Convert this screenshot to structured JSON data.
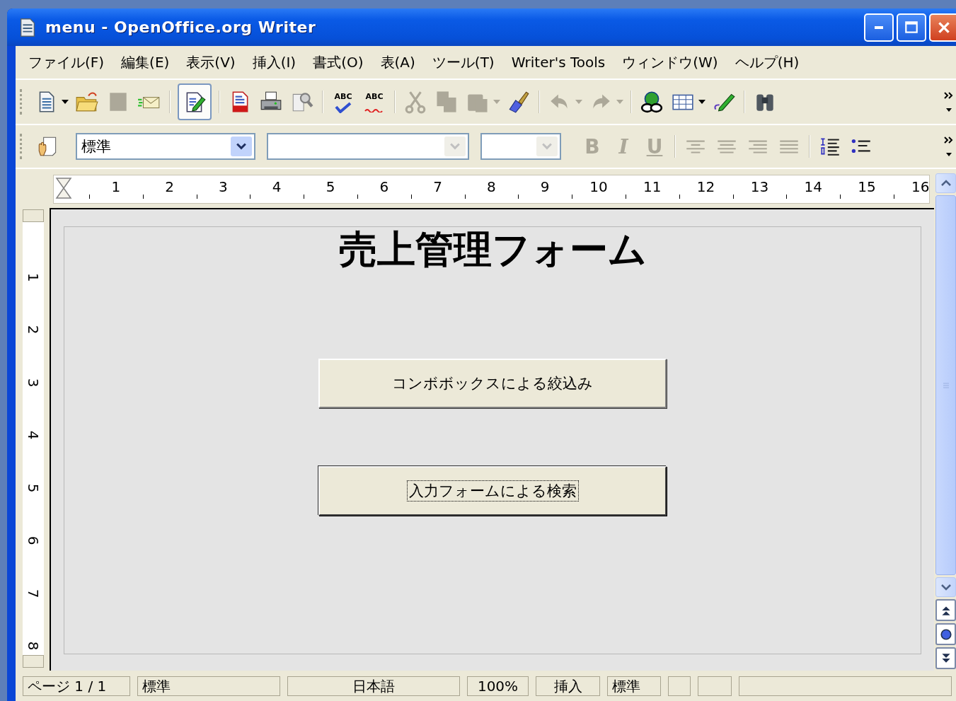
{
  "window": {
    "title": "menu - OpenOffice.org Writer"
  },
  "menu": [
    "ファイル(F)",
    "編集(E)",
    "表示(V)",
    "挿入(I)",
    "書式(O)",
    "表(A)",
    "ツール(T)",
    "Writer's Tools",
    "ウィンドウ(W)",
    "ヘルプ(H)"
  ],
  "toolbar": {
    "items": [
      {
        "kind": "new",
        "disabled": false,
        "on": false
      },
      {
        "kind": "dropdown",
        "disabled": false
      },
      {
        "kind": "open",
        "disabled": false,
        "on": false
      },
      {
        "kind": "save",
        "disabled": true,
        "on": false
      },
      {
        "kind": "email",
        "disabled": false,
        "on": false
      },
      {
        "kind": "separator"
      },
      {
        "kind": "edit",
        "disabled": false,
        "on": true
      },
      {
        "kind": "separator"
      },
      {
        "kind": "pdf",
        "disabled": false,
        "on": false
      },
      {
        "kind": "print",
        "disabled": false,
        "on": false
      },
      {
        "kind": "preview",
        "disabled": false,
        "on": false
      },
      {
        "kind": "separator"
      },
      {
        "kind": "spellcheck",
        "label": "ABC",
        "disabled": false,
        "on": false
      },
      {
        "kind": "autospell",
        "label": "ABC",
        "disabled": false,
        "on": false
      },
      {
        "kind": "separator"
      },
      {
        "kind": "cut",
        "disabled": true,
        "on": false
      },
      {
        "kind": "copy",
        "disabled": true,
        "on": false
      },
      {
        "kind": "paste",
        "disabled": true,
        "on": false
      },
      {
        "kind": "dropdown",
        "disabled": true
      },
      {
        "kind": "brush",
        "disabled": false,
        "on": false
      },
      {
        "kind": "separator"
      },
      {
        "kind": "undo",
        "disabled": true,
        "on": false
      },
      {
        "kind": "dropdown",
        "disabled": true
      },
      {
        "kind": "redo",
        "disabled": true,
        "on": false
      },
      {
        "kind": "dropdown",
        "disabled": true
      },
      {
        "kind": "separator"
      },
      {
        "kind": "globe",
        "disabled": false,
        "on": false
      },
      {
        "kind": "table",
        "disabled": false,
        "on": false
      },
      {
        "kind": "dropdown",
        "disabled": false
      },
      {
        "kind": "draw",
        "disabled": false,
        "on": false
      },
      {
        "kind": "separator"
      },
      {
        "kind": "find",
        "disabled": false,
        "on": false
      }
    ]
  },
  "format_bar": {
    "style_box": {
      "value": "標準",
      "disabled": false
    },
    "font_box": {
      "disabled": true
    },
    "size_box": {
      "disabled": true
    },
    "buttons": [
      {
        "kind": "bold",
        "label": "B",
        "disabled": true
      },
      {
        "kind": "italic",
        "label": "I",
        "disabled": true
      },
      {
        "kind": "underline",
        "label": "U",
        "disabled": true
      },
      {
        "kind": "separator"
      },
      {
        "kind": "align-left",
        "disabled": true
      },
      {
        "kind": "align-center",
        "disabled": true
      },
      {
        "kind": "align-right",
        "disabled": true
      },
      {
        "kind": "justify",
        "disabled": true
      },
      {
        "kind": "separator"
      },
      {
        "kind": "numbering",
        "disabled": false
      },
      {
        "kind": "bullets",
        "disabled": false
      }
    ]
  },
  "ruler": {
    "numbers": [
      "1",
      "2",
      "3",
      "4",
      "5",
      "6",
      "7",
      "8",
      "9",
      "10",
      "11",
      "12",
      "13",
      "14",
      "15",
      "16"
    ]
  },
  "vertical_ruler": {
    "numbers": [
      "1",
      "2",
      "3",
      "4",
      "5",
      "6",
      "7",
      "8"
    ]
  },
  "document": {
    "title": "売上管理フォーム",
    "buttons": [
      {
        "label": "コンボボックスによる絞込み",
        "focused": false
      },
      {
        "label": "入力フォームによる検索",
        "focused": true
      }
    ]
  },
  "status_bar": [
    "ページ 1 / 1",
    "標準",
    "日本語",
    "100%",
    "挿入",
    "標準"
  ]
}
